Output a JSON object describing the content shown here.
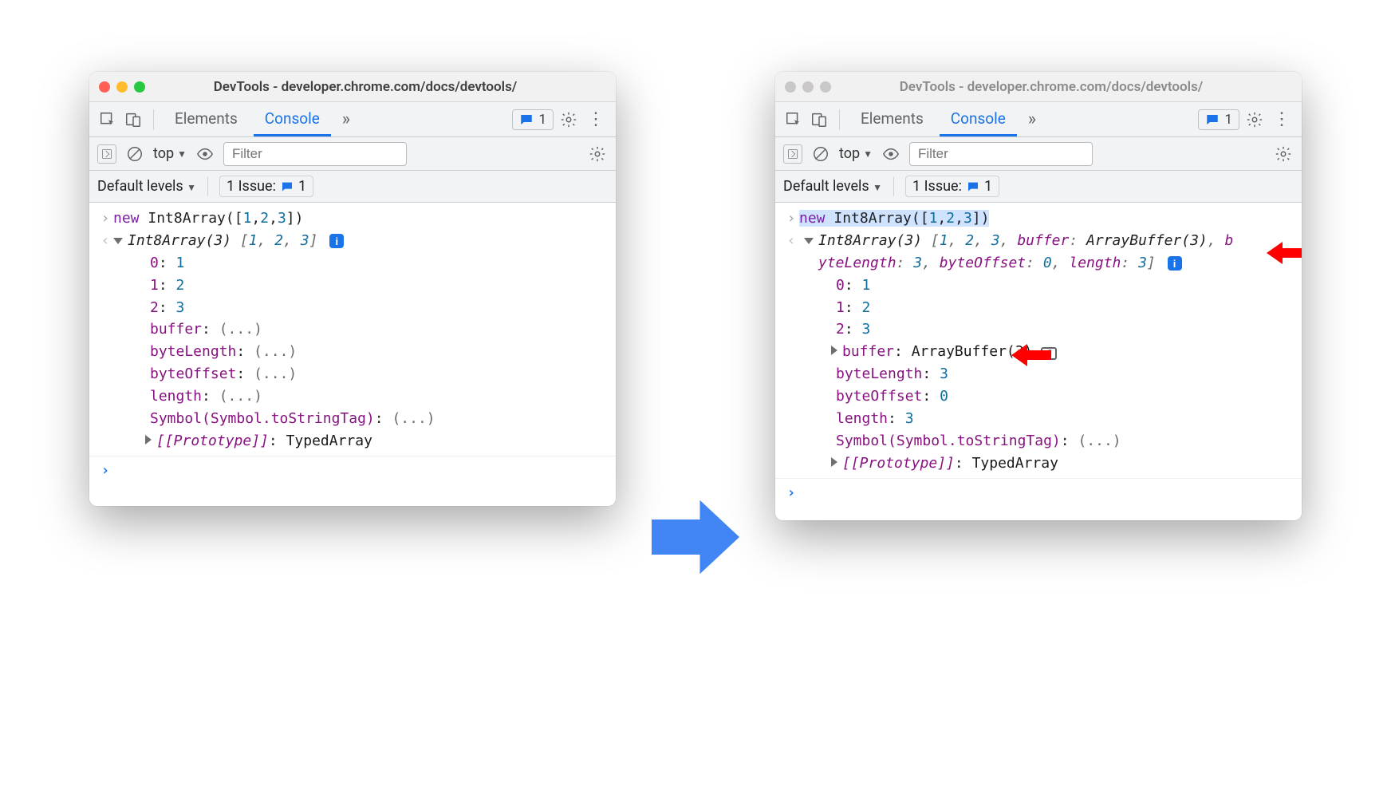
{
  "title": "DevTools - developer.chrome.com/docs/devtools/",
  "tabs": {
    "elements": "Elements",
    "console": "Console"
  },
  "issues_badge": "1",
  "toolbar": {
    "context": "top",
    "filter_placeholder": "Filter",
    "default_levels": "Default levels",
    "issue_label": "1 Issue:",
    "issue_count": "1"
  },
  "input_line": "new Int8Array([1,2,3])",
  "left": {
    "preview": "Int8Array(3) [1, 2, 3]",
    "entries": [
      {
        "k": "0",
        "v": "1"
      },
      {
        "k": "1",
        "v": "2"
      },
      {
        "k": "2",
        "v": "3"
      }
    ],
    "lazy": [
      {
        "k": "buffer",
        "v": "(...)"
      },
      {
        "k": "byteLength",
        "v": "(...)"
      },
      {
        "k": "byteOffset",
        "v": "(...)"
      },
      {
        "k": "length",
        "v": "(...)"
      },
      {
        "k": "Symbol(Symbol.toStringTag)",
        "v": "(...)"
      }
    ],
    "proto_k": "[[Prototype]]",
    "proto_v": "TypedArray"
  },
  "right": {
    "preview_1": "Int8Array(3) [1, 2, 3, buffer: ArrayBuffer(3), b",
    "preview_2": "yteLength: 3, byteOffset: 0, length: 3]",
    "entries": [
      {
        "k": "0",
        "v": "1"
      },
      {
        "k": "1",
        "v": "2"
      },
      {
        "k": "2",
        "v": "3"
      }
    ],
    "buffer_k": "buffer",
    "buffer_v": "ArrayBuffer(3)",
    "props": [
      {
        "k": "byteLength",
        "v": "3"
      },
      {
        "k": "byteOffset",
        "v": "0"
      },
      {
        "k": "length",
        "v": "3"
      },
      {
        "k": "Symbol(Symbol.toStringTag)",
        "v": "(...)"
      }
    ],
    "proto_k": "[[Prototype]]",
    "proto_v": "TypedArray"
  }
}
